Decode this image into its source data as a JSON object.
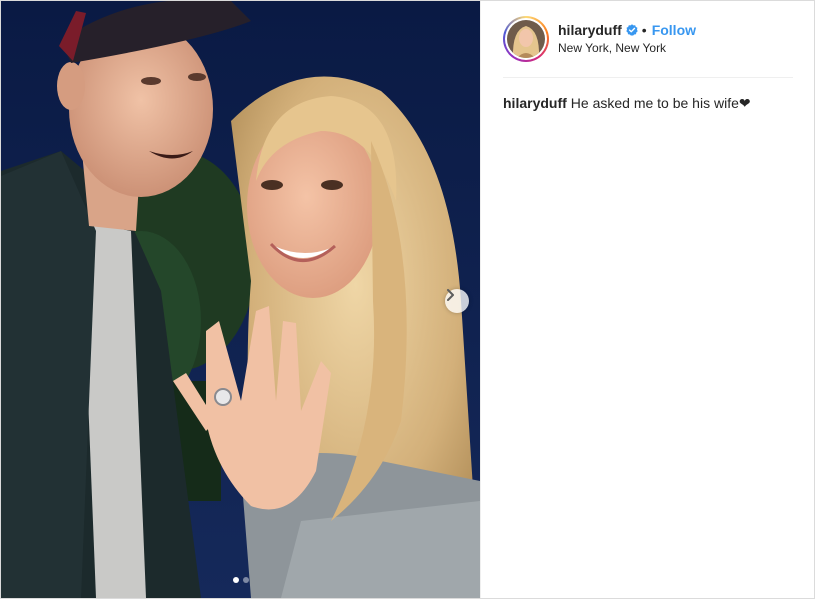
{
  "post": {
    "username": "hilaryduff",
    "verified": true,
    "separator": "•",
    "follow_label": "Follow",
    "location": "New York, New York",
    "caption_text": "He asked me to be his wife❤",
    "carousel": {
      "slide_count": 2,
      "active_slide": 1
    }
  },
  "icons": {
    "verified": "verified-badge-icon",
    "next": "chevron-right-icon"
  },
  "colors": {
    "follow": "#3897f0",
    "verified": "#3897f0",
    "text": "#262626",
    "border": "#dbdbdb"
  }
}
